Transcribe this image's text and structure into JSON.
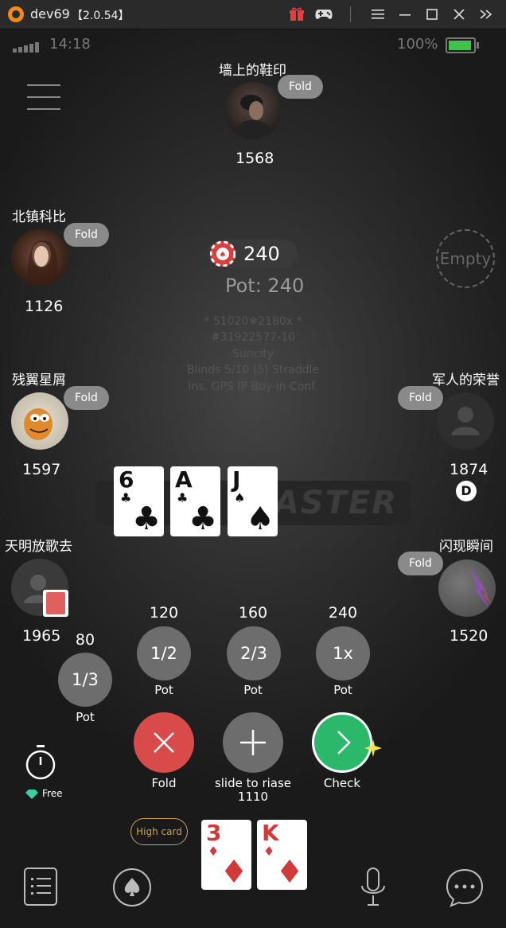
{
  "window": {
    "title": "dev69",
    "version": "【2.0.54】"
  },
  "status_bar": {
    "time": "14:18",
    "battery": "100%"
  },
  "players": {
    "top": {
      "name": "墙上的鞋印",
      "chips": "1568",
      "status": "Fold"
    },
    "left_upper": {
      "name": "北镇科比",
      "chips": "1126",
      "status": "Fold"
    },
    "left_middle": {
      "name": "残翼星屑",
      "chips": "1597",
      "status": "Fold"
    },
    "left_lower": {
      "name": "天明放歌去",
      "chips": "1965"
    },
    "right_middle": {
      "name": "军人的荣誉",
      "chips": "1874",
      "status": "Fold",
      "dealer": "D"
    },
    "right_lower": {
      "name": "闪现瞬间",
      "chips": "1520",
      "status": "Fold"
    }
  },
  "empty_seat": "Empty",
  "pot": {
    "bet": "240",
    "total": "Pot: 240"
  },
  "table_info": [
    "* 51020❄2180x *",
    "#31922577-10",
    "Suncity",
    "Blinds 5/10 (5) Straddle",
    "Ins. GPS IP Buy-in Conf."
  ],
  "brand": "MASTER",
  "board_cards": [
    {
      "rank": "6",
      "suit": "♣"
    },
    {
      "rank": "A",
      "suit": "♣"
    },
    {
      "rank": "J",
      "suit": "♠"
    }
  ],
  "hand_cards": [
    {
      "rank": "3",
      "suit": "♦"
    },
    {
      "rank": "K",
      "suit": "♦"
    }
  ],
  "hand_strength": "High card",
  "bet_options": [
    {
      "amount": "80",
      "fraction": "1/3",
      "label": "Pot"
    },
    {
      "amount": "120",
      "fraction": "1/2",
      "label": "Pot"
    },
    {
      "amount": "160",
      "fraction": "2/3",
      "label": "Pot"
    },
    {
      "amount": "240",
      "fraction": "1x",
      "label": "Pot"
    }
  ],
  "actions": {
    "fold": "Fold",
    "raise": "slide to riase",
    "raise_amount": "1110",
    "check": "Check"
  },
  "timer": {
    "label": "Free"
  },
  "colors": {
    "fold": "#d94a4a",
    "check": "#2bb86a",
    "raise": "#6d6d6d",
    "accent_gold": "#c9a060"
  },
  "icons": [
    "gift-icon",
    "gamepad-icon",
    "minimize-icon",
    "menu-icon",
    "maximize-icon",
    "close-icon",
    "collapse-icon",
    "stopwatch-icon",
    "diamond-icon",
    "hand-history-icon",
    "spade-icon",
    "microphone-icon",
    "chat-icon"
  ]
}
